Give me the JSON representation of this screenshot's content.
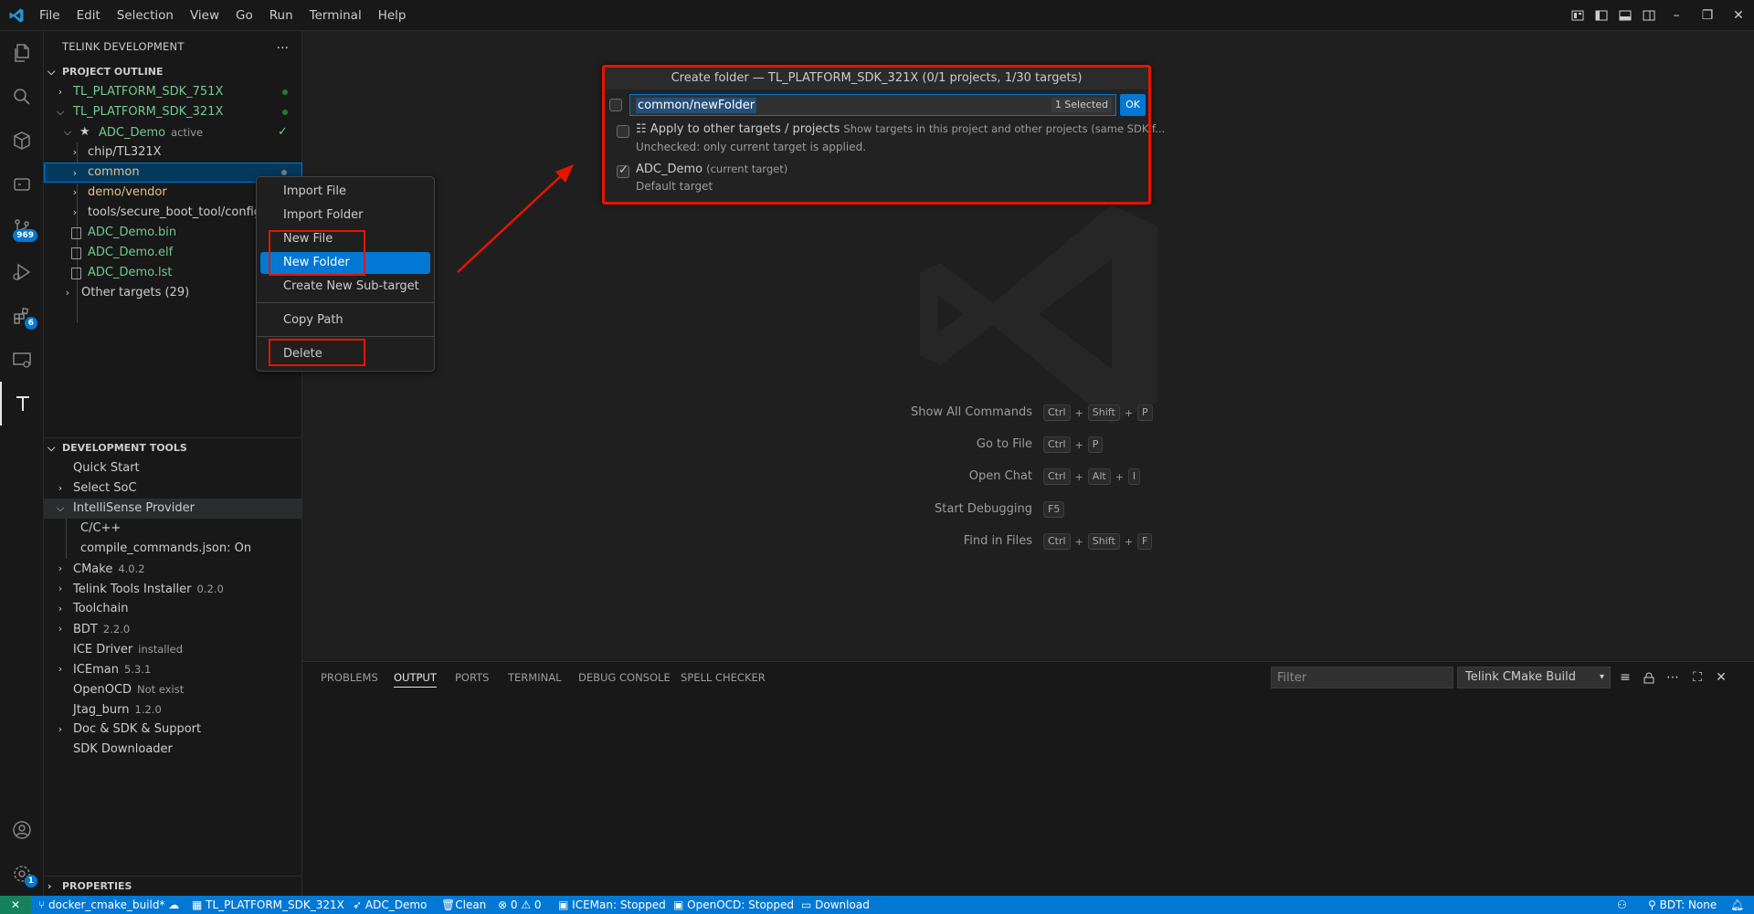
{
  "menubar": [
    "File",
    "Edit",
    "Selection",
    "View",
    "Go",
    "Run",
    "Terminal",
    "Help"
  ],
  "activity_badges": {
    "source_control": "969",
    "extensions": "6",
    "accounts_settings": "1"
  },
  "sidebar": {
    "title": "TELINK DEVELOPMENT",
    "more": "...",
    "project_outline": {
      "header": "PROJECT OUTLINE",
      "rows": [
        {
          "label": "TL_PLATFORM_SDK_751X"
        },
        {
          "label": "TL_PLATFORM_SDK_321X"
        },
        {
          "label": "ADC_Demo",
          "desc": "active",
          "mark": "✓"
        },
        {
          "label": "chip/TL321X"
        },
        {
          "label": "common"
        },
        {
          "label": "demo/vendor"
        },
        {
          "label": "tools/secure_boot_tool/config/"
        },
        {
          "label": "ADC_Demo.bin"
        },
        {
          "label": "ADC_Demo.elf"
        },
        {
          "label": "ADC_Demo.lst"
        },
        {
          "label": "Other targets (29)"
        }
      ]
    },
    "development_tools": {
      "header": "DEVELOPMENT TOOLS",
      "rows": [
        {
          "label": "Quick Start"
        },
        {
          "label": "Select SoC"
        },
        {
          "label": "IntelliSense Provider"
        },
        {
          "label": "C/C++"
        },
        {
          "label": "compile_commands.json: On"
        },
        {
          "label": "CMake",
          "desc": "4.0.2"
        },
        {
          "label": "Telink Tools Installer",
          "desc": "0.2.0"
        },
        {
          "label": "Toolchain"
        },
        {
          "label": "BDT",
          "desc": "2.2.0"
        },
        {
          "label": "ICE Driver",
          "desc": "installed"
        },
        {
          "label": "ICEman",
          "desc": "5.3.1"
        },
        {
          "label": "OpenOCD",
          "desc": "Not exist"
        },
        {
          "label": "Jtag_burn",
          "desc": "1.2.0"
        },
        {
          "label": "Doc & SDK & Support"
        },
        {
          "label": "SDK Downloader"
        }
      ]
    },
    "properties_header": "PROPERTIES"
  },
  "context_menu": {
    "items": [
      "Import File",
      "Import Folder",
      "New File",
      "New Folder",
      "Create New Sub-target",
      "Copy Path",
      "Delete"
    ],
    "active": "New Folder"
  },
  "quick_pick": {
    "title": "Create folder — TL_PLATFORM_SDK_321X (0/1 projects, 1/30 targets)",
    "input_value": "common/newFolder",
    "count": "1 Selected",
    "ok": "OK",
    "items": [
      {
        "label": "Apply to other targets / projects",
        "desc": "Show targets in this project and other projects (same SDK f...",
        "detail": "Unchecked: only current target is applied.",
        "checked": false
      },
      {
        "label": "ADC_Demo",
        "desc": "(current target)",
        "detail": "Default target",
        "checked": true
      }
    ]
  },
  "shortcuts": [
    {
      "label": "Show All Commands",
      "keys": [
        "Ctrl",
        "Shift",
        "P"
      ]
    },
    {
      "label": "Go to File",
      "keys": [
        "Ctrl",
        "P"
      ]
    },
    {
      "label": "Open Chat",
      "keys": [
        "Ctrl",
        "Alt",
        "I"
      ]
    },
    {
      "label": "Start Debugging",
      "keys": [
        "F5"
      ]
    },
    {
      "label": "Find in Files",
      "keys": [
        "Ctrl",
        "Shift",
        "F"
      ]
    }
  ],
  "panel": {
    "tabs": [
      "PROBLEMS",
      "OUTPUT",
      "PORTS",
      "TERMINAL",
      "DEBUG CONSOLE",
      "SPELL CHECKER"
    ],
    "active_tab": "OUTPUT",
    "filter_placeholder": "Filter",
    "channel": "Telink CMake Build"
  },
  "statusbar": {
    "remote": "✕",
    "branch": "docker_cmake_build*",
    "project": "TL_PLATFORM_SDK_321X",
    "target": "ADC_Demo",
    "clean": "Clean",
    "problems": "0",
    "warnings": "0",
    "iceman": "ICEMan: Stopped",
    "openocd": "OpenOCD: Stopped",
    "download": "Download",
    "bdt": "BDT: None"
  },
  "colors": {
    "accent": "#0078d4",
    "annotation": "#e51400",
    "git_added": "#73c991",
    "git_modified": "#e2c08d"
  }
}
